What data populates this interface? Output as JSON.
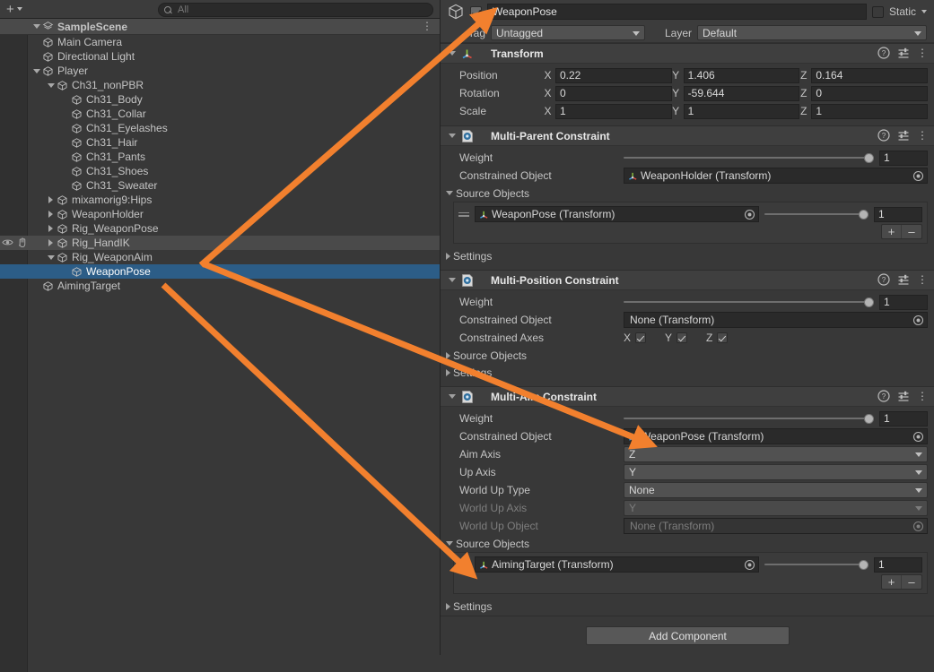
{
  "hierarchy": {
    "toolbar": {
      "add_label": "+",
      "search_placeholder": "All",
      "search_value": ""
    },
    "scene": {
      "name": "SampleScene",
      "icon": "scene-icon",
      "menu_icon": "kebab-icon"
    },
    "items": [
      {
        "label": "Main Camera",
        "depth": 2,
        "twist": "none",
        "state": "normal"
      },
      {
        "label": "Directional Light",
        "depth": 2,
        "twist": "none",
        "state": "normal"
      },
      {
        "label": "Player",
        "depth": 2,
        "twist": "down",
        "state": "normal"
      },
      {
        "label": "Ch31_nonPBR",
        "depth": 3,
        "twist": "down",
        "state": "normal"
      },
      {
        "label": "Ch31_Body",
        "depth": 4,
        "twist": "none",
        "state": "normal"
      },
      {
        "label": "Ch31_Collar",
        "depth": 4,
        "twist": "none",
        "state": "normal"
      },
      {
        "label": "Ch31_Eyelashes",
        "depth": 4,
        "twist": "none",
        "state": "normal"
      },
      {
        "label": "Ch31_Hair",
        "depth": 4,
        "twist": "none",
        "state": "normal"
      },
      {
        "label": "Ch31_Pants",
        "depth": 4,
        "twist": "none",
        "state": "normal"
      },
      {
        "label": "Ch31_Shoes",
        "depth": 4,
        "twist": "none",
        "state": "normal"
      },
      {
        "label": "Ch31_Sweater",
        "depth": 4,
        "twist": "none",
        "state": "normal"
      },
      {
        "label": "mixamorig9:Hips",
        "depth": 3,
        "twist": "right",
        "state": "normal"
      },
      {
        "label": "WeaponHolder",
        "depth": 3,
        "twist": "right",
        "state": "normal"
      },
      {
        "label": "Rig_WeaponPose",
        "depth": 3,
        "twist": "right",
        "state": "normal"
      },
      {
        "label": "Rig_HandIK",
        "depth": 3,
        "twist": "right",
        "state": "hover"
      },
      {
        "label": "Rig_WeaponAim",
        "depth": 3,
        "twist": "down",
        "state": "normal"
      },
      {
        "label": "WeaponPose",
        "depth": 4,
        "twist": "none",
        "state": "selected"
      },
      {
        "label": "AimingTarget",
        "depth": 2,
        "twist": "none",
        "state": "normal"
      }
    ],
    "hover_icons": {
      "visibility": "eye-icon",
      "picking": "hand-icon"
    }
  },
  "inspector": {
    "header": {
      "object_icon": "gameobject-cube-icon",
      "enabled": true,
      "name": "WeaponPose",
      "static_label": "Static",
      "static_checked": false
    },
    "tag_row": {
      "tag_label": "Tag",
      "tag_value": "Untagged",
      "layer_label": "Layer",
      "layer_value": "Default"
    },
    "transform": {
      "title": "Transform",
      "icon": "transform-axis-icon",
      "rows": [
        {
          "label": "Position",
          "x": "0.22",
          "y": "1.406",
          "z": "0.164"
        },
        {
          "label": "Rotation",
          "x": "0",
          "y": "-59.644",
          "z": "0"
        },
        {
          "label": "Scale",
          "x": "1",
          "y": "1",
          "z": "1"
        }
      ],
      "axis_labels": {
        "x": "X",
        "y": "Y",
        "z": "Z"
      }
    },
    "multi_parent": {
      "title": "Multi-Parent Constraint",
      "icon": "script-icon",
      "weight_label": "Weight",
      "weight_value": "1",
      "weight_slider_pct": 100,
      "constrained_object_label": "Constrained Object",
      "constrained_object_value": "WeaponHolder (Transform)",
      "source_objects_label": "Source Objects",
      "source_objects": [
        {
          "value": "WeaponPose (Transform)",
          "weight": "1",
          "slider_pct": 100
        }
      ],
      "add_label": "+",
      "remove_label": "–",
      "settings_label": "Settings"
    },
    "multi_position": {
      "title": "Multi-Position Constraint",
      "icon": "script-icon",
      "weight_label": "Weight",
      "weight_value": "1",
      "weight_slider_pct": 100,
      "constrained_object_label": "Constrained Object",
      "constrained_object_value": "None (Transform)",
      "constrained_axes_label": "Constrained Axes",
      "axes": [
        {
          "name": "X",
          "checked": true
        },
        {
          "name": "Y",
          "checked": true
        },
        {
          "name": "Z",
          "checked": true
        }
      ],
      "source_objects_label": "Source Objects",
      "settings_label": "Settings"
    },
    "multi_aim": {
      "title": "Multi-Aim Constraint",
      "icon": "script-icon",
      "weight_label": "Weight",
      "weight_value": "1",
      "weight_slider_pct": 100,
      "constrained_object_label": "Constrained Object",
      "constrained_object_value": "WeaponPose (Transform)",
      "aim_axis_label": "Aim Axis",
      "aim_axis_value": "Z",
      "up_axis_label": "Up Axis",
      "up_axis_value": "Y",
      "world_up_type_label": "World Up Type",
      "world_up_type_value": "None",
      "world_up_axis_label": "World Up Axis",
      "world_up_axis_value": "Y",
      "world_up_object_label": "World Up Object",
      "world_up_object_value": "None (Transform)",
      "source_objects_label": "Source Objects",
      "source_objects": [
        {
          "value": "AimingTarget (Transform)",
          "weight": "1",
          "slider_pct": 100
        }
      ],
      "add_label": "+",
      "remove_label": "–",
      "settings_label": "Settings"
    },
    "add_component_label": "Add Component"
  },
  "annotations": {
    "color": "#f2802e",
    "arrows": [
      {
        "name": "arrow-weaponpose-to-name-field",
        "from": [
          224,
          296
        ],
        "to": [
          541,
          20
        ]
      },
      {
        "name": "arrow-weaponpose-to-aim-object",
        "from": [
          228,
          295
        ],
        "to": [
          716,
          492
        ]
      },
      {
        "name": "arrow-aimingtarget-to-aim-source",
        "from": [
          182,
          318
        ],
        "to": [
          519,
          634
        ]
      }
    ]
  },
  "colors": {
    "panel_bg": "#383838",
    "header_bg": "#3c3c3c",
    "field_bg": "#2a2a2a",
    "selection_blue": "#2c5d87",
    "hover_gray": "#4a4a4a",
    "accent_orange": "#f2802e",
    "text": "#c4c4c4"
  }
}
